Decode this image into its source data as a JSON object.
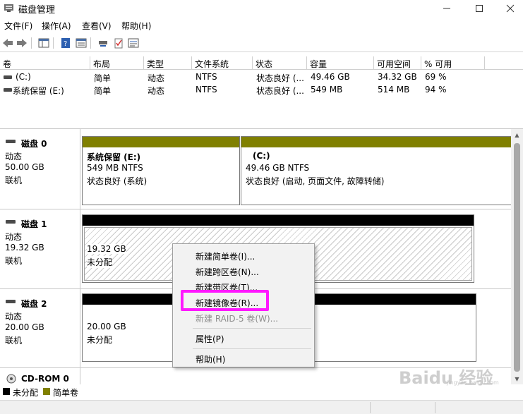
{
  "window": {
    "title": "磁盘管理"
  },
  "menu": [
    "文件(F)",
    "操作(A)",
    "查看(V)",
    "帮助(H)"
  ],
  "volume_table": {
    "columns": [
      "卷",
      "布局",
      "类型",
      "文件系统",
      "状态",
      "容量",
      "可用空间",
      "% 可用"
    ],
    "rows": [
      [
        "(C:)",
        "简单",
        "动态",
        "NTFS",
        "状态良好 (...",
        "49.46 GB",
        "34.32 GB",
        "69 %"
      ],
      [
        "系统保留 (E:)",
        "简单",
        "动态",
        "NTFS",
        "状态良好 (...",
        "549 MB",
        "514 MB",
        "94 %"
      ]
    ]
  },
  "disks": [
    {
      "name": "磁盘 0",
      "type": "动态",
      "size": "50.00 GB",
      "state": "联机",
      "partitions": [
        {
          "title": "系统保留  (E:)",
          "size": "549 MB NTFS",
          "status": "状态良好 (系统)"
        },
        {
          "title": "(C:)",
          "size": "49.46 GB NTFS",
          "status": "状态良好 (启动, 页面文件, 故障转储)"
        }
      ]
    },
    {
      "name": "磁盘 1",
      "type": "动态",
      "size": "19.32 GB",
      "state": "联机",
      "partitions": [
        {
          "size": "19.32 GB",
          "status": "未分配"
        }
      ]
    },
    {
      "name": "磁盘 2",
      "type": "动态",
      "size": "20.00 GB",
      "state": "联机",
      "partitions": [
        {
          "size": "20.00 GB",
          "status": "未分配"
        }
      ]
    },
    {
      "name": "CD-ROM 0"
    }
  ],
  "legend": [
    {
      "label": "未分配",
      "color": "#000000"
    },
    {
      "label": "简单卷",
      "color": "#808000"
    }
  ],
  "context_menu": {
    "items": [
      {
        "label": "新建简单卷(I)...",
        "enabled": true
      },
      {
        "label": "新建跨区卷(N)...",
        "enabled": true
      },
      {
        "label": "新建带区卷(T)...",
        "enabled": true
      },
      {
        "label": "新建镜像卷(R)...",
        "enabled": true,
        "highlighted": true
      },
      {
        "label": "新建 RAID-5 卷(W)...",
        "enabled": false
      },
      {
        "label": "属性(P)",
        "enabled": true
      },
      {
        "label": "帮助(H)",
        "enabled": true
      }
    ],
    "highlight_color": "#ff18ff"
  },
  "watermark": {
    "text": "Baidu 经验",
    "sub": "jingyan.baidu.com"
  },
  "colors": {
    "simple_volume": "#808000",
    "unallocated": "#000000"
  }
}
